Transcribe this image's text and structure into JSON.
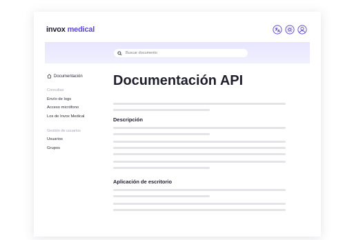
{
  "brand": {
    "part1": "invox",
    "part2": "medical",
    "accent": "#5b47e0"
  },
  "header": {
    "icons": [
      {
        "name": "translate-icon"
      },
      {
        "name": "theme-icon"
      },
      {
        "name": "account-icon"
      }
    ]
  },
  "search": {
    "placeholder": "Buscar documento",
    "value": ""
  },
  "sidebar": {
    "doc_link": "Documentación",
    "groups": [
      {
        "title": "Consultas",
        "items": [
          "Envío de logs",
          "Acceso micrófono",
          "Los de Invox Medical"
        ]
      },
      {
        "title": "Gestión de usuarios",
        "items": [
          "Usuarios",
          "Grupos"
        ]
      }
    ]
  },
  "main": {
    "title": "Documentación API",
    "sections": [
      {
        "title": "Descripción"
      },
      {
        "title": "Aplicación de escritorio"
      }
    ]
  }
}
